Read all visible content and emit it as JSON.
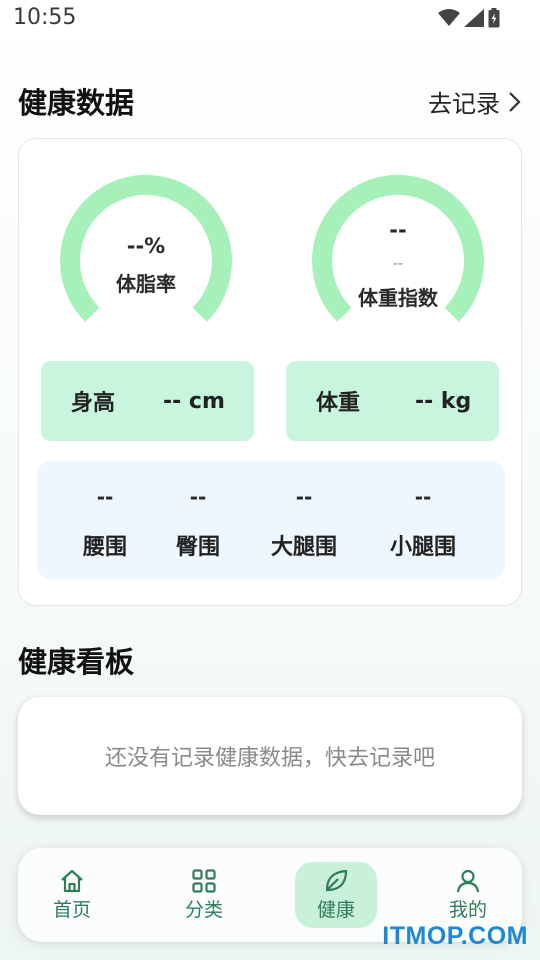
{
  "status_bar": {
    "time": "10:55"
  },
  "health_data": {
    "title": "健康数据",
    "record_link": "去记录",
    "body_fat": {
      "value": "--%",
      "label": "体脂率"
    },
    "bmi": {
      "value": "--",
      "sub": "--",
      "label": "体重指数"
    },
    "height": {
      "label": "身高",
      "value": "-- cm"
    },
    "weight": {
      "label": "体重",
      "value": "-- kg"
    },
    "girths": [
      {
        "label": "腰围",
        "value": "--"
      },
      {
        "label": "臀围",
        "value": "--"
      },
      {
        "label": "大腿围",
        "value": "--"
      },
      {
        "label": "小腿围",
        "value": "--"
      }
    ]
  },
  "dashboard": {
    "title": "健康看板",
    "empty_text": "还没有记录健康数据，快去记录吧"
  },
  "nav": {
    "items": [
      {
        "label": "首页",
        "icon": "home-icon"
      },
      {
        "label": "分类",
        "icon": "grid-icon"
      },
      {
        "label": "健康",
        "icon": "leaf-icon",
        "active": true
      },
      {
        "label": "我的",
        "icon": "user-icon"
      }
    ]
  },
  "watermark": "ITMOP.COM",
  "colors": {
    "accent": "#2f7d5a",
    "gauge": "#a6f0b9",
    "metric_bg": "#c8f5de",
    "girth_bg": "#eef7fd"
  }
}
